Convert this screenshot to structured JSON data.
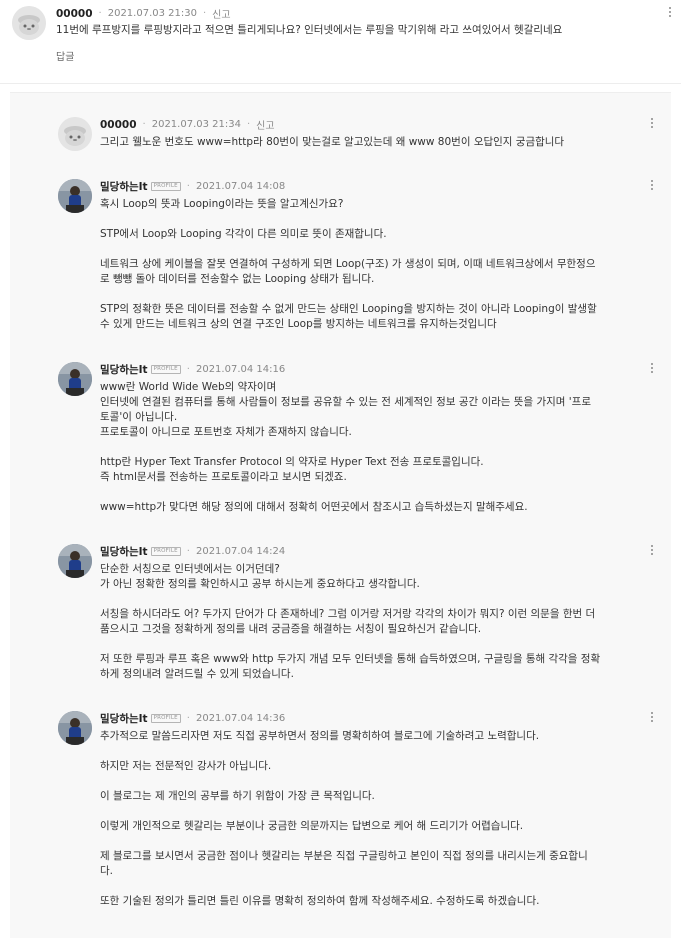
{
  "comments": [
    {
      "nickname": "00000",
      "date": "2021.07.03 21:30",
      "report_label": "신고",
      "reply_label": "답글",
      "paragraphs": [
        "11번에 루프방지를 루핑방지라고 적으면 틀리게되나요? 인터넷에서는 루핑을 막기위해 라고 쓰여있어서 헷갈리네요"
      ]
    }
  ],
  "replies": [
    {
      "nickname": "00000",
      "date": "2021.07.03 21:34",
      "report_label": "신고",
      "paragraphs": [
        "그리고 웰노운 번호도 www=http라 80번이 맞는걸로 알고있는데 왜 www 80번이 오답인지 궁금합니다"
      ]
    },
    {
      "nickname": "밀당하는It",
      "badge": "PROFILE",
      "date": "2021.07.04 14:08",
      "paragraphs": [
        "혹시 Loop의 뜻과 Looping이라는 뜻을 알고계신가요?",
        "STP에서 Loop와 Looping 각각이 다른 의미로 뜻이 존재합니다.",
        "네트워크 상에 케이블을 잘못 연결하여 구성하게 되면 Loop(구조) 가 생성이 되며, 이때 네트워크상에서 무한정으\n로 뺑뺑 돌아 데이터를 전송할수 없는 Looping 상태가 됩니다.",
        "STP의 정확한 뜻은 데이터를 전송할 수 없게 만드는 상태인 Looping을 방지하는 것이 아니라 Looping이 발생할\n수 있게 만드는 네트워크 상의 연결 구조인 Loop를 방지하는 네트워크를 유지하는것입니다"
      ]
    },
    {
      "nickname": "밀당하는It",
      "badge": "PROFILE",
      "date": "2021.07.04 14:16",
      "paragraphs": [
        "www란 World Wide Web의 약자이며\n인터넷에 연결된 컴퓨터를 통해 사람들이 정보를 공유할 수 있는 전 세계적인 정보 공간 이라는 뜻을 가지며 '프로\n토콜'이 아닙니다.\n프로토콜이 아니므로 포트번호 자체가 존재하지 않습니다.",
        "http란 Hyper Text Transfer Protocol 의 약자로 Hyper Text 전송 프로토콜입니다.\n즉 html문서를 전송하는 프로토콜이라고 보시면 되겠죠.",
        "www=http가 맞다면 해당 정의에 대해서 정확히 어떤곳에서 참조시고 습득하셨는지 말해주세요."
      ]
    },
    {
      "nickname": "밀당하는It",
      "badge": "PROFILE",
      "date": "2021.07.04 14:24",
      "paragraphs": [
        "단순한 서칭으로 인터넷에서는 이거던데?\n가 아닌 정확한 정의를 확인하시고 공부 하시는게 중요하다고 생각합니다.",
        "서칭을 하시더라도 어? 두가지 단어가 다 존재하네? 그럼 이거랑 저거랑 각각의 차이가 뭐지? 이런 의문을 한번 더\n품으시고 그것을 정확하게 정의를 내려 궁금증을 해결하는 서칭이 필요하신거 같습니다.",
        "저 또한 루핑과 루프 혹은 www와 http 두가지 개념 모두 인터넷을 통해 습득하였으며, 구글링을 통해 각각을 정확\n하게 정의내려 알려드릴 수 있게 되었습니다."
      ]
    },
    {
      "nickname": "밀당하는It",
      "badge": "PROFILE",
      "date": "2021.07.04 14:36",
      "paragraphs": [
        "추가적으로 말씀드리자면 저도 직접 공부하면서 정의를 명확히하여 블로그에 기술하려고 노력합니다.",
        "하지만 저는 전문적인 강사가 아닙니다.",
        "이 블로그는 제 개인의 공부를 하기 위함이 가장 큰 목적입니다.",
        "이렇게 개인적으로 헷갈리는 부분이나 궁금한 의문까지는 답변으로 케어 해 드리기가 어렵습니다.",
        "제 블로그를 보시면서 궁금한 점이나 헷갈리는 부분은 직접 구글링하고 본인이 직접 정의를 내리시는게 중요합니\n다.",
        "또한 기술된 정의가 틀리면 틀린 이유를 명확히 정의하여 함께 작성해주세요. 수정하도록 하겠습니다."
      ]
    }
  ],
  "colors": {
    "thread_background": "#f8f8f8",
    "text": "#333333",
    "meta_text": "#888888"
  }
}
